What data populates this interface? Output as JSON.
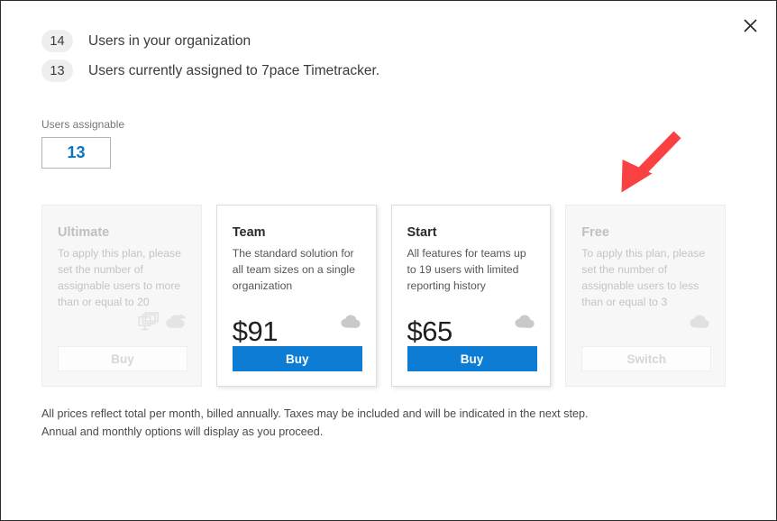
{
  "window": {
    "close_label": "×",
    "close_icon": "close-icon"
  },
  "summary": {
    "rows": [
      {
        "count": "14",
        "text": "Users in your organization"
      },
      {
        "count": "13",
        "text": "Users currently assigned to 7pace Timetracker."
      }
    ]
  },
  "assignable": {
    "label": "Users assignable",
    "value": "13",
    "placeholder": "0"
  },
  "annotation": {
    "type": "arrow",
    "icon": "red-arrow-icon",
    "color": "#fa4141",
    "points_to": "free-plan-card",
    "direction": "down-left"
  },
  "plans": {
    "cards": [
      {
        "name": "Ultimate",
        "description": "To apply this plan, please set the number of assignable users to more than or equal to 20",
        "price": "",
        "action_label": "Buy",
        "enabled": false,
        "icons": [
          "on-premise-servers-icon",
          "multi-cloud-icon"
        ]
      },
      {
        "name": "Team",
        "description": "The standard solution for all team sizes on a single organization",
        "price": "$91",
        "action_label": "Buy",
        "enabled": true,
        "icons": [
          "cloud-icon"
        ]
      },
      {
        "name": "Start",
        "description": "All features for teams up to 19 users with limited reporting history",
        "price": "$65",
        "action_label": "Buy",
        "enabled": true,
        "icons": [
          "cloud-icon"
        ]
      },
      {
        "name": "Free",
        "description": "To apply this plan, please set the number of assignable users to less than or equal to 3",
        "price": "",
        "action_label": "Switch",
        "enabled": false,
        "icons": [
          "cloud-icon"
        ]
      }
    ]
  },
  "footer": {
    "line1": "All prices reflect total per month, billed annually. Taxes may be included and will be indicated in the next step.",
    "line2": "Annual and monthly options will display as you proceed."
  },
  "colors": {
    "accent_blue": "#0c7cd5",
    "value_blue": "#0a74c4",
    "annotation_red": "#fa4141",
    "badge_gray": "#eeeeee",
    "disabled_card_bg": "#f7f7f7"
  }
}
